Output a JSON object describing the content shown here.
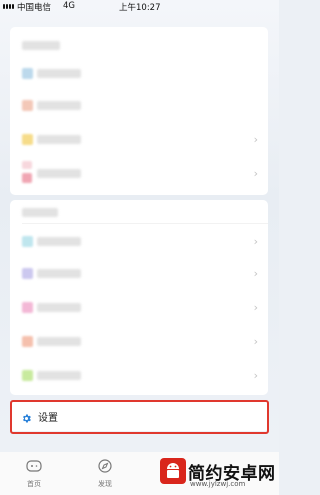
{
  "status_bar": {
    "carrier": "中国电信",
    "network": "4G",
    "time": "上午10:27"
  },
  "settings": {
    "label": "设置"
  },
  "tabbar": {
    "tabs": [
      {
        "label": "首页"
      },
      {
        "label": "发现"
      }
    ]
  },
  "watermark": {
    "name": "简约安卓网",
    "url": "www.jylzwj.com"
  },
  "colors": {
    "highlight_border": "#e0382e",
    "settings_icon": "#2b82d9",
    "watermark_red": "#d9261c"
  }
}
